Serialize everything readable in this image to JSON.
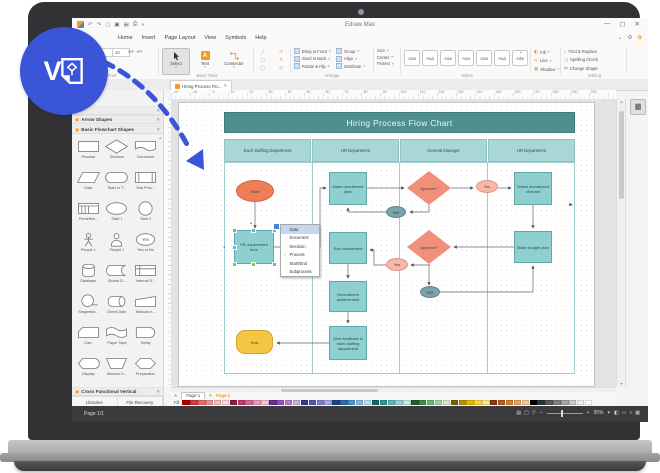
{
  "window": {
    "title": "Edraw Max",
    "controls": [
      "—",
      "▢",
      "✕"
    ],
    "qat": [
      "↶",
      "↷",
      "▢",
      "▣",
      "▤",
      "⎙",
      "»"
    ],
    "extra_icons": [
      "⌄",
      "⚙",
      "✿"
    ]
  },
  "menu": {
    "tabs": [
      "Home",
      "Insert",
      "Page Layout",
      "View",
      "Symbols",
      "Help"
    ]
  },
  "ribbon": {
    "font": {
      "caption": "Font",
      "size_value": "10",
      "glyphs": [
        "B",
        "U",
        "A",
        "≡"
      ]
    },
    "basic_tools": {
      "caption": "Basic Tools",
      "buttons": [
        "Select",
        "Text",
        "Connector"
      ]
    },
    "draw_glyphs": [
      "╱",
      "↺",
      "▢",
      "✕",
      "◯",
      "⊙"
    ],
    "arrange": {
      "caption": "Arrange",
      "left": [
        "Bring to Front",
        "Send to Back",
        "Rotate & Flip"
      ],
      "right": [
        "Group",
        "Align",
        "Distribute"
      ],
      "extra": [
        "Size",
        "Center",
        "Protect"
      ]
    },
    "styles": {
      "caption": "Styles",
      "samples": [
        "Aaa",
        "Aaa",
        "Aaa",
        "Aaa",
        "Aaa",
        "Aaa",
        "Aaa"
      ]
    },
    "format_items": [
      {
        "icon": "◧",
        "label": "Fill"
      },
      {
        "icon": "✎",
        "label": "Line"
      },
      {
        "icon": "▦",
        "label": "Shadow"
      }
    ],
    "editing": {
      "caption": "Editing",
      "items": [
        {
          "icon": "⌕",
          "label": "Find & Replace"
        },
        {
          "icon": "❏",
          "label": "Spelling Check"
        },
        {
          "icon": "⇆",
          "label": "Change Shape"
        }
      ]
    }
  },
  "doc_tab": {
    "label": "Hiring Process Flo...",
    "close": "✕"
  },
  "ruler": {
    "h_labels": [
      "-20",
      "-10",
      "0",
      "10",
      "20",
      "30",
      "40",
      "50",
      "60",
      "70",
      "80",
      "90",
      "100",
      "110",
      "120",
      "130",
      "140",
      "150",
      "160",
      "170",
      "180",
      "190",
      "200"
    ]
  },
  "sidebar": {
    "panel1": "Arrow Shapes",
    "panel2": "Basic Flowchart Shapes",
    "shapes": [
      {
        "label": "Process",
        "shape": "process"
      },
      {
        "label": "Decision",
        "shape": "decision"
      },
      {
        "label": "Document",
        "shape": "document"
      },
      {
        "label": "Data",
        "shape": "data"
      },
      {
        "label": "Start or T...",
        "shape": "startterm"
      },
      {
        "label": "Sub Proc...",
        "shape": "subprocess"
      },
      {
        "label": "Predefine...",
        "shape": "predefined"
      },
      {
        "label": "Start 1",
        "shape": "start1"
      },
      {
        "label": "Start 2",
        "shape": "start2"
      },
      {
        "label": "People 1",
        "shape": "people1"
      },
      {
        "label": "People 2",
        "shape": "people2"
      },
      {
        "label": "Yes or No",
        "shape": "yesorno"
      },
      {
        "label": "Database",
        "shape": "database"
      },
      {
        "label": "Stored D...",
        "shape": "storedd"
      },
      {
        "label": "Internal S...",
        "shape": "internals"
      },
      {
        "label": "Sequentia...",
        "shape": "sequential"
      },
      {
        "label": "Direct Data",
        "shape": "directdata"
      },
      {
        "label": "Manual In...",
        "shape": "manualin"
      },
      {
        "label": "Card",
        "shape": "card"
      },
      {
        "label": "Paper Tape",
        "shape": "papertape"
      },
      {
        "label": "Delay",
        "shape": "delay"
      },
      {
        "label": "Display",
        "shape": "display"
      },
      {
        "label": "Manual O...",
        "shape": "manualop"
      },
      {
        "label": "Preparation",
        "shape": "preparation"
      }
    ],
    "bottom_panel": "Cross Functional Vertical",
    "tabs": [
      "Libraries",
      "File Recovery"
    ]
  },
  "chart": {
    "title": "Hiring Process Flow Chart",
    "lanes": [
      "Each Staffing Department",
      "HR Department",
      "General Manager",
      "HR Department"
    ],
    "nodes": {
      "start": "Start",
      "fill_form": "Fill requirement form",
      "make_plan": "Make recruitment plan",
      "approve1": "Approve?",
      "no1": "NO",
      "yes1": "Yes",
      "select_channel": "Select recruitment channel",
      "run_recruitment": "Run recruitment",
      "approve2": "Approve?",
      "yes2": "Yes",
      "no2": "NO",
      "make_budget": "Make budget plan",
      "achievement": "Recruitment achievement",
      "feedback": "Give feedback to each staffing department",
      "end": "End"
    }
  },
  "popup": {
    "check_glyph": "✓",
    "items": [
      {
        "label": "Data",
        "highlight": true
      },
      {
        "label": "Document"
      },
      {
        "label": "Decision"
      },
      {
        "label": "Process",
        "checked": true
      },
      {
        "label": "Start/End"
      },
      {
        "label": "Subprocess"
      }
    ]
  },
  "pagebar": {
    "caret": "∧",
    "tab": "Page-1",
    "add": "+",
    "active": "Page-1",
    "fill_label": "Fill"
  },
  "palette": [
    "#b40000",
    "#d83a3a",
    "#e66a6a",
    "#ef9595",
    "#f7c0c0",
    "#fbdcdc",
    "#8c1d4b",
    "#c23a72",
    "#d96a97",
    "#e898b8",
    "#f3c3d6",
    "#6b2d8c",
    "#9a4fbf",
    "#b67ed3",
    "#d2aee5",
    "#3a3a8c",
    "#5555c2",
    "#7d7dd8",
    "#a8a8e8",
    "#1c4587",
    "#2f6db3",
    "#4f94d4",
    "#86b9e4",
    "#bcdcf2",
    "#0f6b6b",
    "#2d9999",
    "#5cbcbc",
    "#93d5d5",
    "#c8eaea",
    "#275e2b",
    "#3f8f45",
    "#6ab96f",
    "#a0d6a3",
    "#d0ecd1",
    "#7f6000",
    "#bf9000",
    "#e6b800",
    "#ffd633",
    "#ffe68c",
    "#843c0c",
    "#b45f1d",
    "#d98032",
    "#eda55f",
    "#f7c893",
    "#000000",
    "#333333",
    "#595959",
    "#808080",
    "#a6a6a6",
    "#cccccc",
    "#f2f2f2",
    "#ffffff"
  ],
  "dock": {
    "icons": [
      {
        "glyph": "◧",
        "name": "format-panel-icon",
        "selected": true
      },
      {
        "glyph": "✎",
        "name": "line-style-icon"
      },
      {
        "glyph": "■",
        "name": "fill-color-icon",
        "color": "#f59a23"
      },
      {
        "glyph": "▦",
        "name": "picture-icon"
      },
      {
        "glyph": "❐",
        "name": "shadow-icon",
        "color": "#f59a23"
      },
      {
        "glyph": "❏",
        "name": "document-icon"
      },
      {
        "glyph": "☺",
        "name": "clipart-icon",
        "color": "#e8913d"
      },
      {
        "glyph": "✐",
        "name": "pen-icon"
      },
      {
        "glyph": "✉",
        "name": "comment-icon"
      },
      {
        "glyph": "?",
        "name": "help-icon"
      }
    ]
  },
  "statusbar": {
    "page_indicator": "Page 1/1",
    "view_icons": [
      "▤",
      "▢",
      "▽"
    ],
    "zoom_out": "–",
    "zoom_in": "+",
    "zoom_value": "95%",
    "caret": "▾",
    "right_icons": [
      "◧",
      "▭",
      "⌕",
      "▦"
    ]
  },
  "badge": {
    "letter": "V"
  },
  "colors": {
    "accent_orange": "#f59a23",
    "chart_header": "#4e8f8f",
    "lane_header": "#a9d6d6",
    "node_teal": "#8ecfcf",
    "node_salmon": "#f0907a",
    "node_salmon_light": "#f8b7a7",
    "node_gray_teal": "#7aa4aa",
    "node_yellow": "#f5c545",
    "node_orange": "#ef7d55",
    "badge_blue": "#3b55d9",
    "statusbar_dark": "#3b3b3d"
  }
}
